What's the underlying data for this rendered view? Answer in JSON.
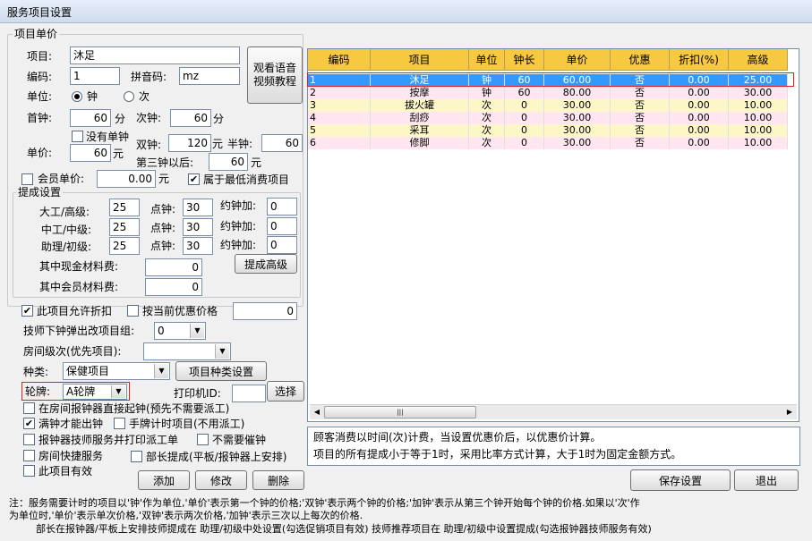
{
  "window": {
    "title": "服务项目设置"
  },
  "group_unit_price": {
    "title": "项目单价"
  },
  "fields": {
    "item_label": "项目:",
    "item_value": "沐足",
    "code_label": "编码:",
    "code_value": "1",
    "pinyin_label": "拼音码:",
    "pinyin_value": "mz",
    "unit_label": "单位:",
    "unit_options": [
      "钟",
      "次"
    ],
    "unit_selected": "钟",
    "first_clock_label": "首钟:",
    "first_clock_value": "60",
    "first_clock_unit": "分",
    "next_clock_label": "次钟:",
    "next_clock_value": "60",
    "next_clock_unit": "分",
    "no_unit_clock_label": "没有单钟",
    "no_unit_clock_checked": false,
    "unit_price_label": "单价:",
    "unit_price_value": "60",
    "unit_price_unit": "元",
    "double_clock_label": "双钟:",
    "double_clock_value": "120",
    "double_clock_unit": "元",
    "half_clock_label": "半钟:",
    "half_clock_value": "60",
    "half_clock_unit": "元",
    "third_clock_label": "第三钟以后:",
    "third_clock_value": "60",
    "third_clock_unit": "元",
    "member_price_label": "会员单价:",
    "member_price_checked": false,
    "member_price_value": "0.00",
    "member_price_unit": "元",
    "min_consume_label": "属于最低消费项目",
    "min_consume_checked": true
  },
  "video_button_label": "观看语音\n视频教程",
  "commission": {
    "title": "提成设置",
    "rows": [
      {
        "label": "大工/高级:",
        "value": "25",
        "point_label": "点钟:",
        "point_value": "30",
        "appoint_label": "约钟加:",
        "appoint_value": "0"
      },
      {
        "label": "中工/中级:",
        "value": "25",
        "point_label": "点钟:",
        "point_value": "30",
        "appoint_label": "约钟加:",
        "appoint_value": "0"
      },
      {
        "label": "助理/初级:",
        "value": "25",
        "point_label": "点钟:",
        "point_value": "30",
        "appoint_label": "约钟加:",
        "appoint_value": "0"
      }
    ],
    "advanced_button": "提成高级",
    "cash_material_label": "其中现金材料费:",
    "cash_material_value": "0",
    "member_material_label": "其中会员材料费:",
    "member_material_value": "0"
  },
  "options": {
    "allow_discount_label": "此项目允许折扣",
    "allow_discount_checked": true,
    "current_price_label": "按当前优惠价格",
    "current_price_checked": false,
    "current_price_value": "0",
    "tech_popup_label": "技师下钟弹出改项目组:",
    "tech_popup_value": "0",
    "room_level_label": "房间级次(优先项目):",
    "room_level_value": "",
    "category_label": "种类:",
    "category_value": "保健项目",
    "category_button": "项目种类设置",
    "rotation_label": "轮牌:",
    "rotation_value": "A轮牌",
    "printer_label": "打印机ID:",
    "printer_value": "",
    "select_button": "选择",
    "checks": [
      {
        "label": "在房间报钟器直接起钟(预先不需要派工)",
        "checked": false
      },
      {
        "label": "满钟才能出钟",
        "checked": true
      },
      {
        "label": "手牌计时项目(不用派工)",
        "checked": false
      },
      {
        "label": "报钟器技师服务并打印派工单",
        "checked": false
      },
      {
        "label": "不需要催钟",
        "checked": false
      },
      {
        "label": "房间快捷服务",
        "checked": false
      },
      {
        "label": "部长提成(平板/报钟器上安排)",
        "checked": false
      },
      {
        "label": "此项目有效",
        "checked": false
      }
    ]
  },
  "buttons": {
    "add": "添加",
    "edit": "修改",
    "delete": "删除",
    "save": "保存设置",
    "exit": "退出"
  },
  "table": {
    "columns": [
      "编码",
      "项目",
      "单位",
      "钟长",
      "单价",
      "优惠",
      "折扣(%)",
      "高级"
    ],
    "rows": [
      [
        "1",
        "沐足",
        "钟",
        "60",
        "60.00",
        "否",
        "0.00",
        "25.00"
      ],
      [
        "2",
        "按摩",
        "钟",
        "60",
        "80.00",
        "否",
        "0.00",
        "30.00"
      ],
      [
        "3",
        "拔火罐",
        "次",
        "0",
        "30.00",
        "否",
        "0.00",
        "10.00"
      ],
      [
        "4",
        "刮痧",
        "次",
        "0",
        "30.00",
        "否",
        "0.00",
        "10.00"
      ],
      [
        "5",
        "采耳",
        "次",
        "0",
        "30.00",
        "否",
        "0.00",
        "10.00"
      ],
      [
        "6",
        "修脚",
        "次",
        "0",
        "30.00",
        "否",
        "0.00",
        "10.00"
      ]
    ],
    "row_colors": [
      "#3399ff",
      "#ffe6f0",
      "#fdf7c8",
      "#ffe6f0",
      "#fdf7c8",
      "#ffe6f0"
    ],
    "selected_row": 0,
    "scroll_grip": "|||"
  },
  "info": {
    "line1": "顾客消费以时间(次)计费，当设置优惠价后，以优惠价计算。",
    "line2": "项目的所有提成小于等于1时，采用比率方式计算，大于1时为固定金额方式。"
  },
  "notes": {
    "line1": "注：服务需要计时的项目以'钟'作为单位,'单价'表示第一个钟的价格;'双钟'表示两个钟的价格;'加钟'表示从第三个钟开始每个钟的价格.如果以'次'作",
    "line2": "为单位时,'单价'表示单次价格,'双钟'表示两次价格,'加钟'表示三次以上每次的价格.",
    "line3": "部长在报钟器/平板上安排技师提成在 助理/初级中处设置(勾选促销项目有效)   技师推荐项目在 助理/初级中设置提成(勾选报钟器技师服务有效)"
  },
  "colors": {
    "header": "#f6c940",
    "selection": "#3399ff",
    "highlight_border": "#e02020"
  }
}
